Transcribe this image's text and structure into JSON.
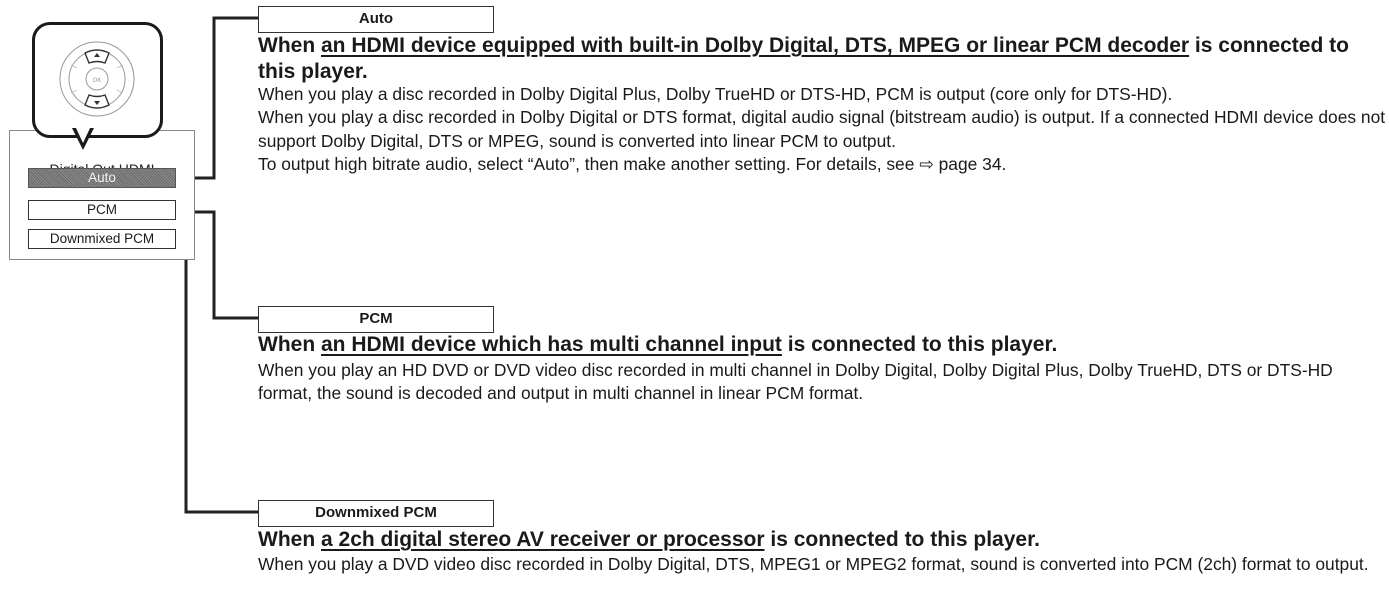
{
  "menu": {
    "title": "Digital Out HDMI",
    "items": [
      {
        "label": "Auto",
        "selected": true
      },
      {
        "label": "PCM",
        "selected": false
      },
      {
        "label": "Downmixed PCM",
        "selected": false
      }
    ]
  },
  "options": [
    {
      "label": "Auto",
      "heading_prefix": "When ",
      "heading_underlined": "an HDMI device equipped with built-in Dolby Digital, DTS, MPEG or linear PCM decoder",
      "heading_suffix": " is connected to this player.",
      "paragraphs": [
        "When you play a disc recorded in Dolby Digital Plus, Dolby TrueHD or DTS-HD, PCM is output (core only for DTS-HD).",
        "When you play a disc recorded in Dolby Digital or DTS format, digital audio signal (bitstream audio) is output. If a connected HDMI device does not support Dolby Digital, DTS or MPEG, sound is converted into linear PCM to output.",
        "To output high bitrate audio, select “Auto”, then make another setting. For details, see ⇨ page 34."
      ]
    },
    {
      "label": "PCM",
      "heading_prefix": "When ",
      "heading_underlined": "an HDMI device which has multi channel input",
      "heading_suffix": " is connected to this player.",
      "paragraphs": [
        "When you play an HD DVD or DVD video disc recorded in multi channel in Dolby Digital, Dolby Digital Plus, Dolby TrueHD, DTS or DTS-HD format, the sound is decoded and output in multi channel in linear PCM format."
      ]
    },
    {
      "label": "Downmixed PCM",
      "heading_prefix": "When ",
      "heading_underlined": "a 2ch digital stereo AV receiver or processor",
      "heading_suffix": " is connected to this player.",
      "paragraphs": [
        "When you play a DVD video disc recorded in Dolby Digital, DTS, MPEG1 or MPEG2 format, sound is converted into PCM (2ch) format to output."
      ]
    }
  ]
}
